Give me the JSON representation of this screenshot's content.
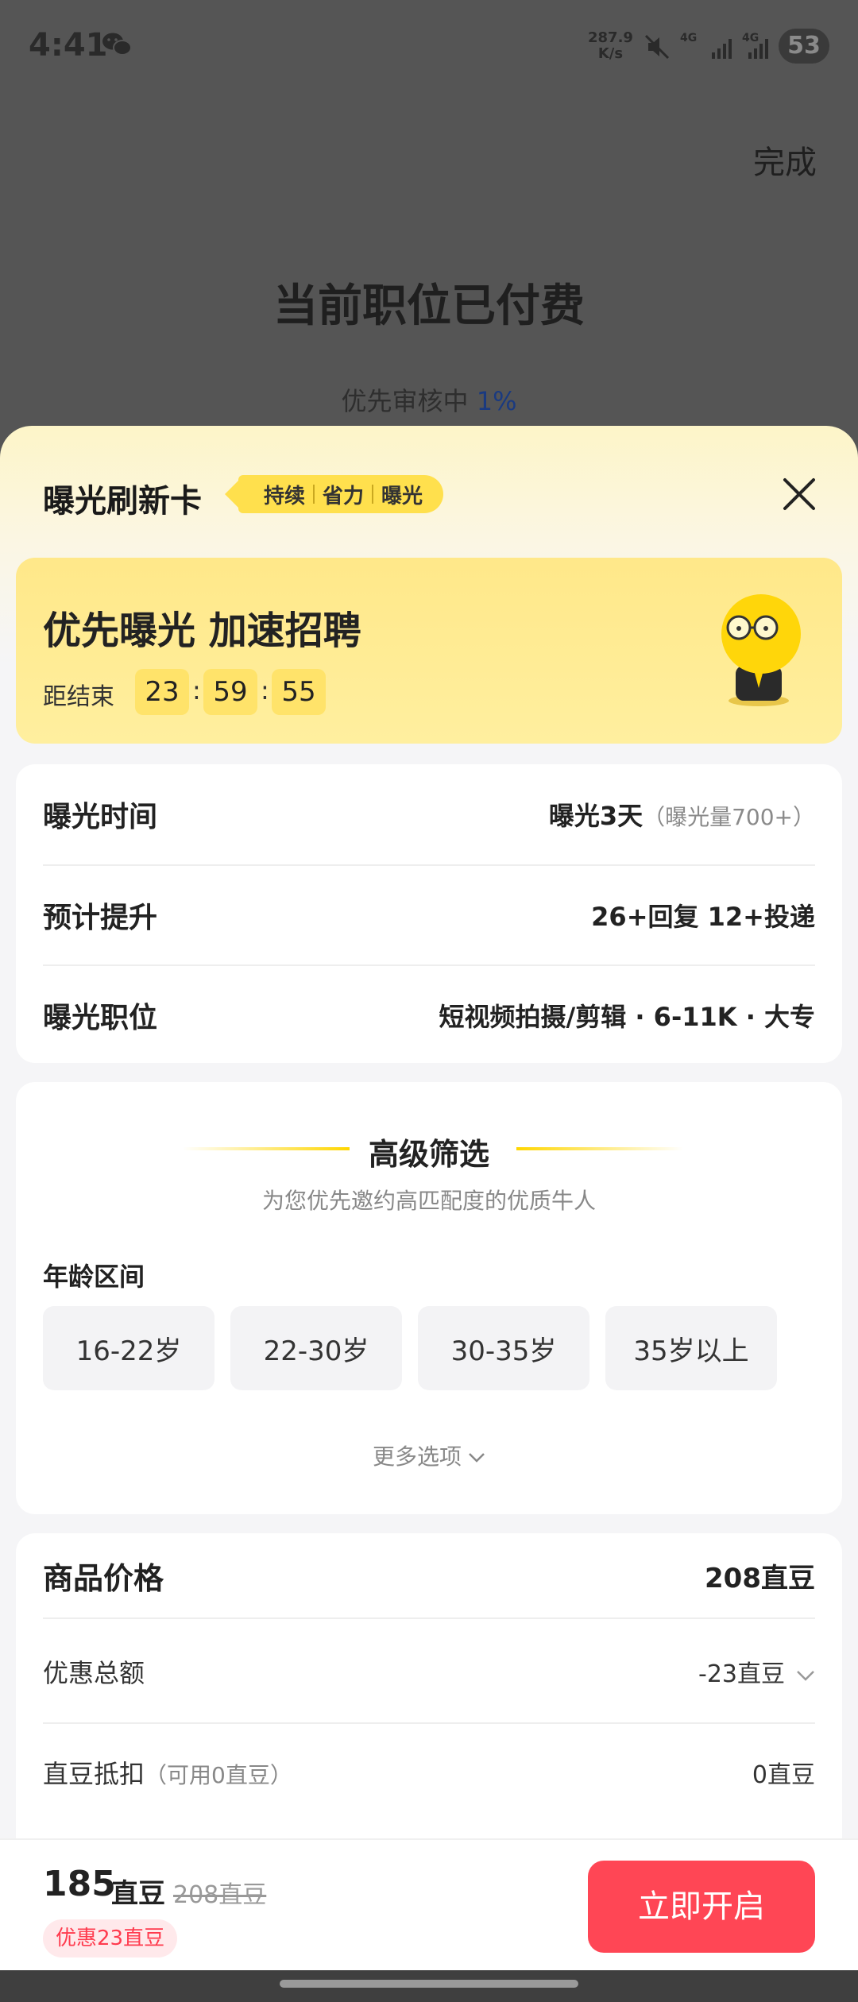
{
  "status_bar": {
    "time": "4:41",
    "speed_value": "287.9",
    "speed_unit": "K/s",
    "net1": "4G",
    "net2": "4G",
    "battery": "53",
    "icons": [
      "wechat-icon",
      "mute-icon",
      "signal-icon",
      "signal-icon",
      "battery-icon"
    ]
  },
  "background_page": {
    "done_label": "完成",
    "title": "当前职位已付费",
    "status_text": "优先审核中",
    "status_pct": "1%"
  },
  "sheet": {
    "title": "曝光刷新卡",
    "tags": [
      "持续",
      "省力",
      "曝光"
    ],
    "promo": {
      "headline": "优先曝光 加速招聘",
      "countdown_label": "距结束",
      "hours": "23",
      "minutes": "59",
      "seconds": "55"
    },
    "info_rows": [
      {
        "key": "曝光时间",
        "value": "曝光3天",
        "sub": "（曝光量700+）"
      },
      {
        "key": "预计提升",
        "value": "26+回复 12+投递",
        "sub": ""
      },
      {
        "key": "曝光职位",
        "value": "短视频拍摄/剪辑 · 6-11K · 大专",
        "sub": ""
      }
    ],
    "filter": {
      "title": "高级筛选",
      "subtitle": "为您优先邀约高匹配度的优质牛人",
      "age_label": "年龄区间",
      "age_options": [
        "16-22岁",
        "22-30岁",
        "30-35岁",
        "35岁以上"
      ],
      "more_label": "更多选项"
    },
    "price": {
      "goods_label": "商品价格",
      "goods_value": "208直豆",
      "discount_label": "优惠总额",
      "discount_value": "-23直豆",
      "deduct_label": "直豆抵扣",
      "deduct_sub": "（可用0直豆）",
      "deduct_value": "0直豆"
    },
    "bottom": {
      "amount": "185",
      "unit": "直豆",
      "original": "208直豆",
      "discount_badge": "优惠23直豆",
      "cta": "立即开启"
    }
  },
  "colors": {
    "accent_yellow": "#ffe04d",
    "cta_red": "#ff4655",
    "link_blue": "#1a3a80"
  }
}
